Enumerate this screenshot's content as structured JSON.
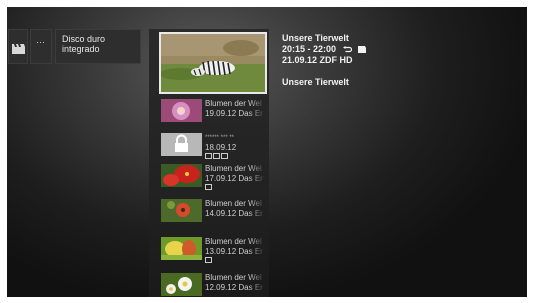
{
  "categories": {
    "dots_label": "···",
    "disk_label": "Disco duro integrado"
  },
  "featured": {
    "title": "Unsere Tierwelt",
    "time": "20:15 - 22:00",
    "date_channel": "21.09.12  ZDF HD",
    "description": "Unsere Tierwelt"
  },
  "recordings": [
    {
      "title": "Blumen der Wel",
      "sub": "19.09.12 Das Er",
      "icons": 0
    },
    {
      "title": "****** *** **",
      "sub": "18.09.12",
      "icons": 3
    },
    {
      "title": "Blumen der Wel",
      "sub": "17.09.12 Das Er",
      "icons": 1
    },
    {
      "title": "Blumen der Wel",
      "sub": "14.09.12 Das Er",
      "icons": 0
    },
    {
      "title": "Blumen der Wel",
      "sub": "13.09.12 Das Er",
      "icons": 1
    },
    {
      "title": "Blumen der Wel",
      "sub": "12.09.12 Das Er",
      "icons": 0
    }
  ]
}
